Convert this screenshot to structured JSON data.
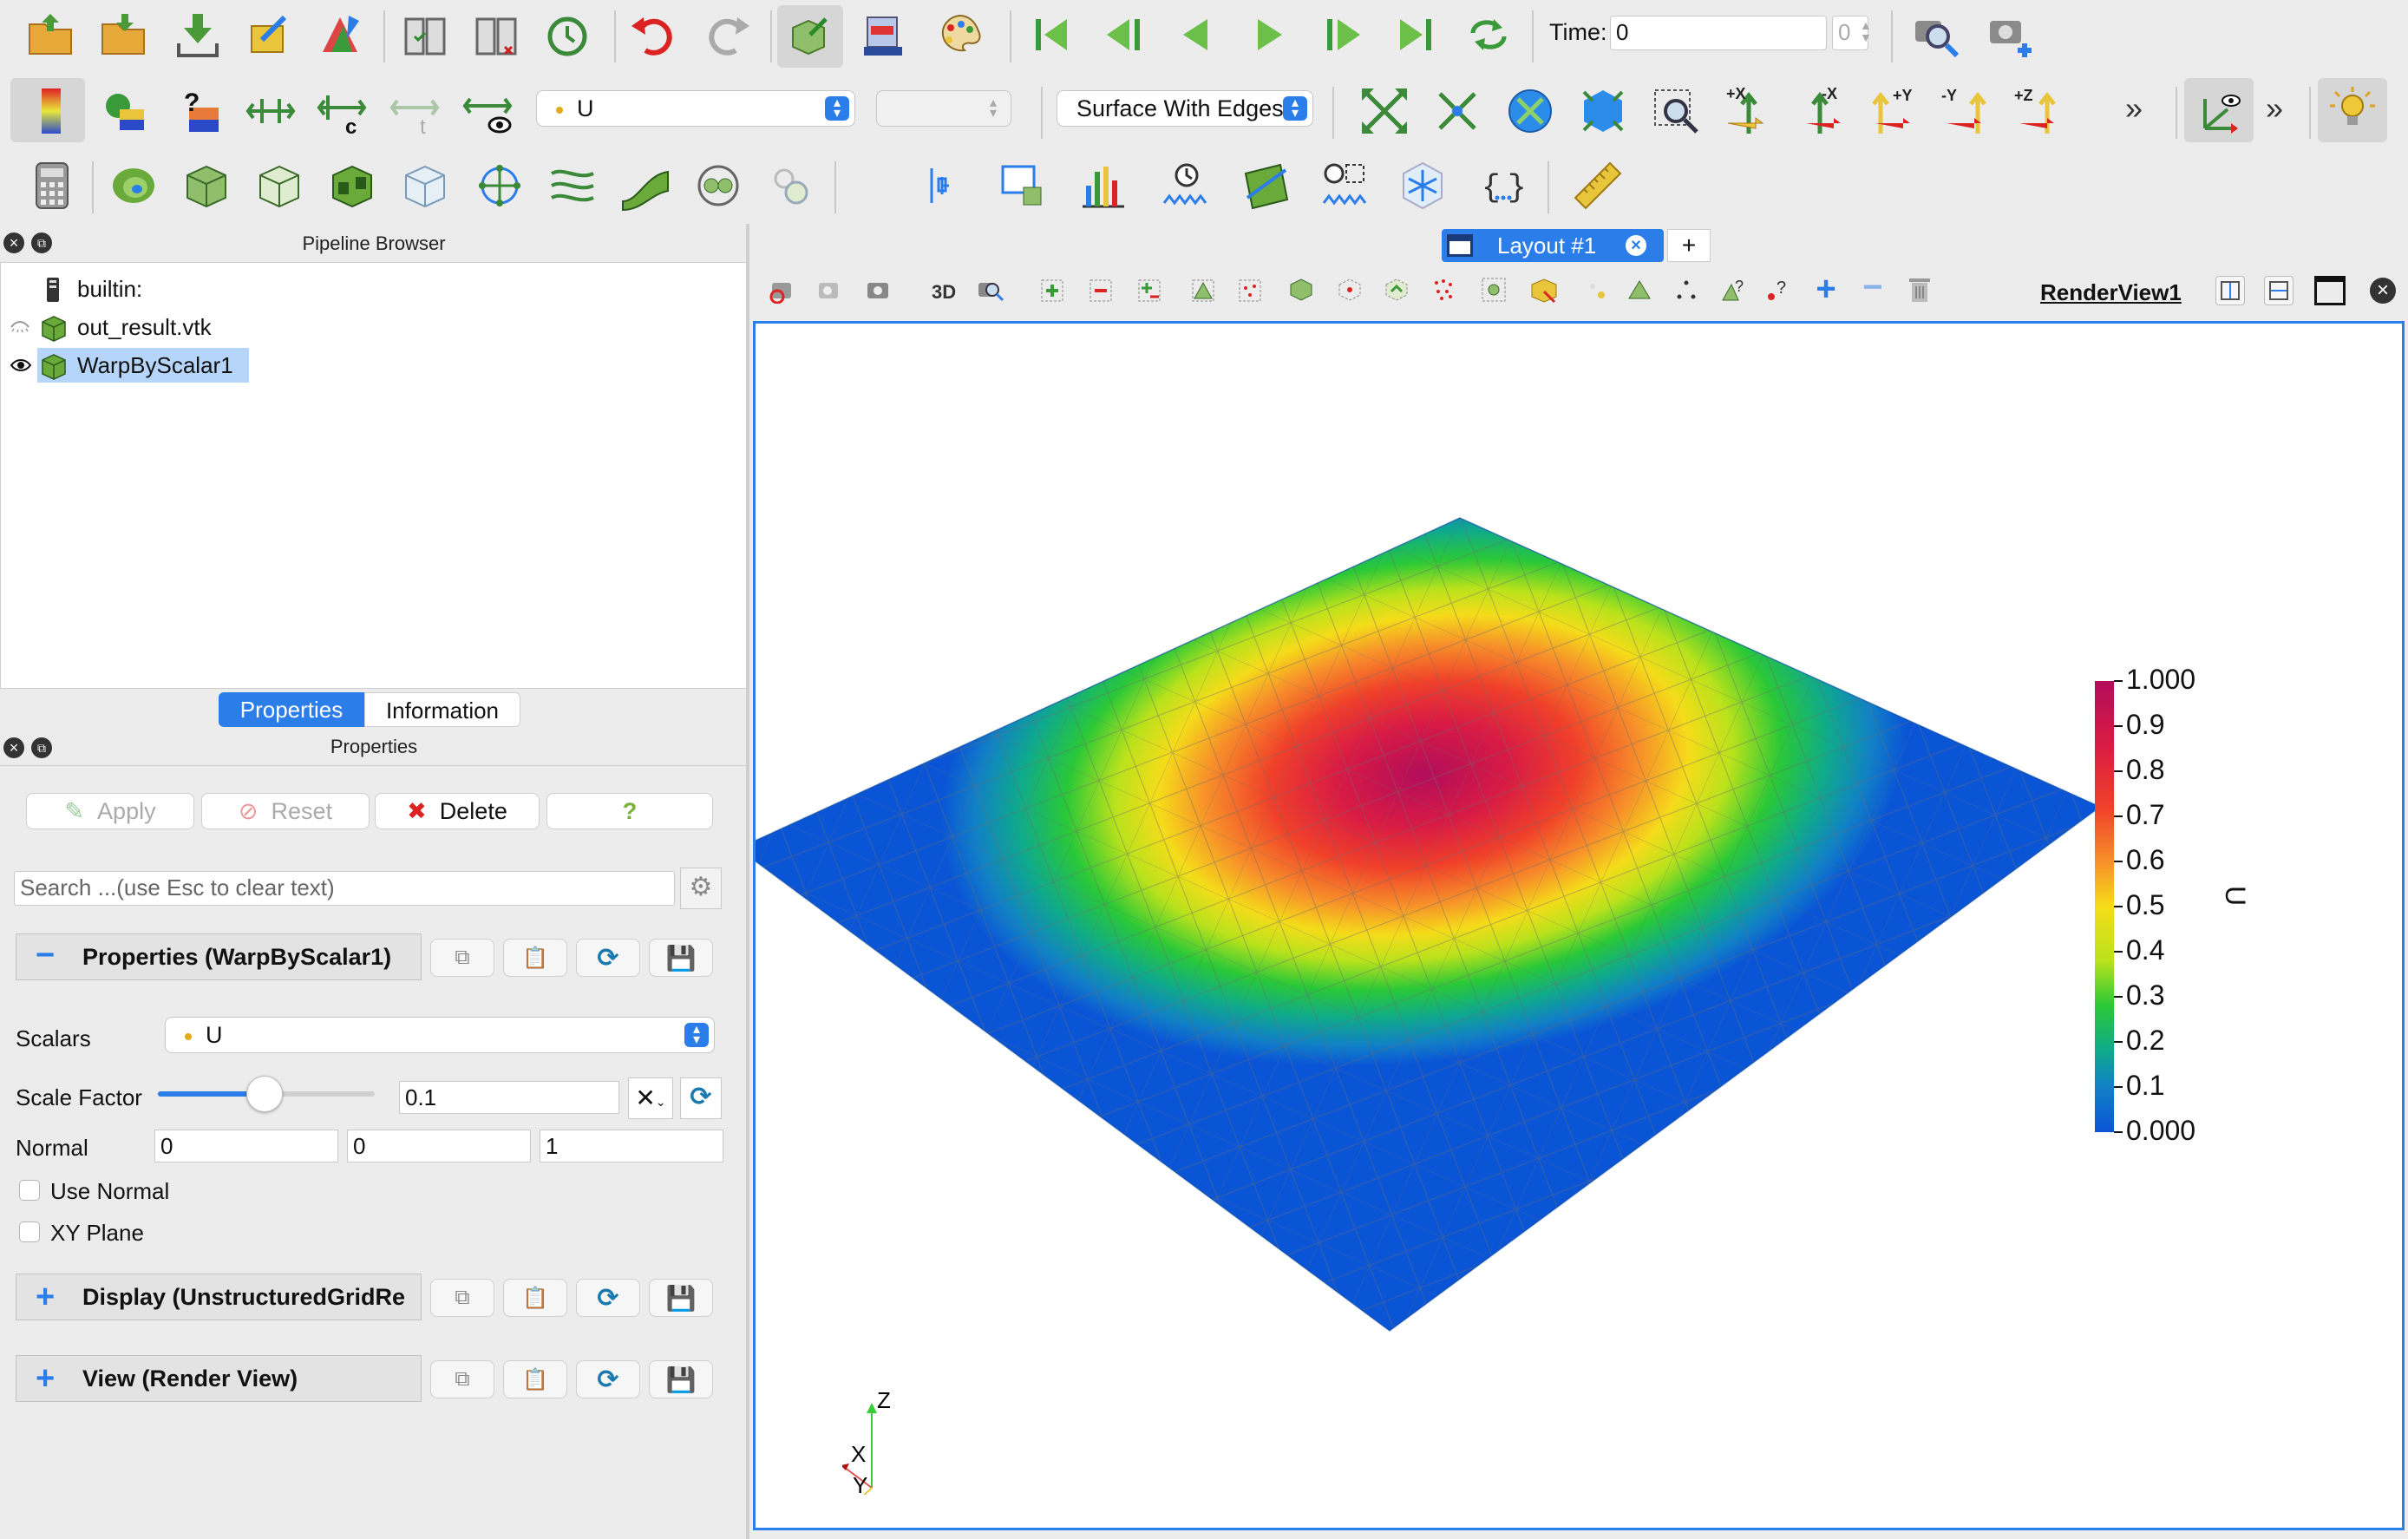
{
  "toolbar1": {
    "time_label": "Time:",
    "time_value": "0",
    "time_index": "0"
  },
  "toolbar2": {
    "array_combo": "U",
    "component_combo": "",
    "representation_combo": "Surface With Edges",
    "cam_labels": [
      "+X",
      "-X",
      "+Y",
      "-Y",
      "+Z"
    ]
  },
  "pipeline": {
    "title": "Pipeline Browser",
    "items": [
      {
        "label": "builtin:"
      },
      {
        "label": "out_result.vtk"
      },
      {
        "label": "WarpByScalar1"
      }
    ]
  },
  "tabs": {
    "properties": "Properties",
    "information": "Information"
  },
  "properties_panel": {
    "title": "Properties",
    "apply": "Apply",
    "reset": "Reset",
    "delete": "Delete",
    "help": "?",
    "search_placeholder": "Search ...(use Esc to clear text)",
    "section_properties": "Properties (WarpByScalar1)",
    "scalars_label": "Scalars",
    "scalars_value": "U",
    "scale_factor_label": "Scale Factor",
    "scale_factor_value": "0.1",
    "normal_label": "Normal",
    "normal_x": "0",
    "normal_y": "0",
    "normal_z": "1",
    "use_normal": "Use Normal",
    "xy_plane": "XY Plane",
    "section_display": "Display (UnstructuredGridRe",
    "section_view": "View (Render View)"
  },
  "layout": {
    "tab_label": "Layout #1",
    "add_tab": "+",
    "view_label": "RenderView1",
    "mode_3d": "3D"
  },
  "colorbar": {
    "title": "U",
    "ticks": [
      "1.000",
      "0.9",
      "0.8",
      "0.7",
      "0.6",
      "0.5",
      "0.4",
      "0.3",
      "0.2",
      "0.1",
      "0.000"
    ]
  },
  "axes": {
    "x": "X",
    "y": "Y",
    "z": "Z"
  }
}
